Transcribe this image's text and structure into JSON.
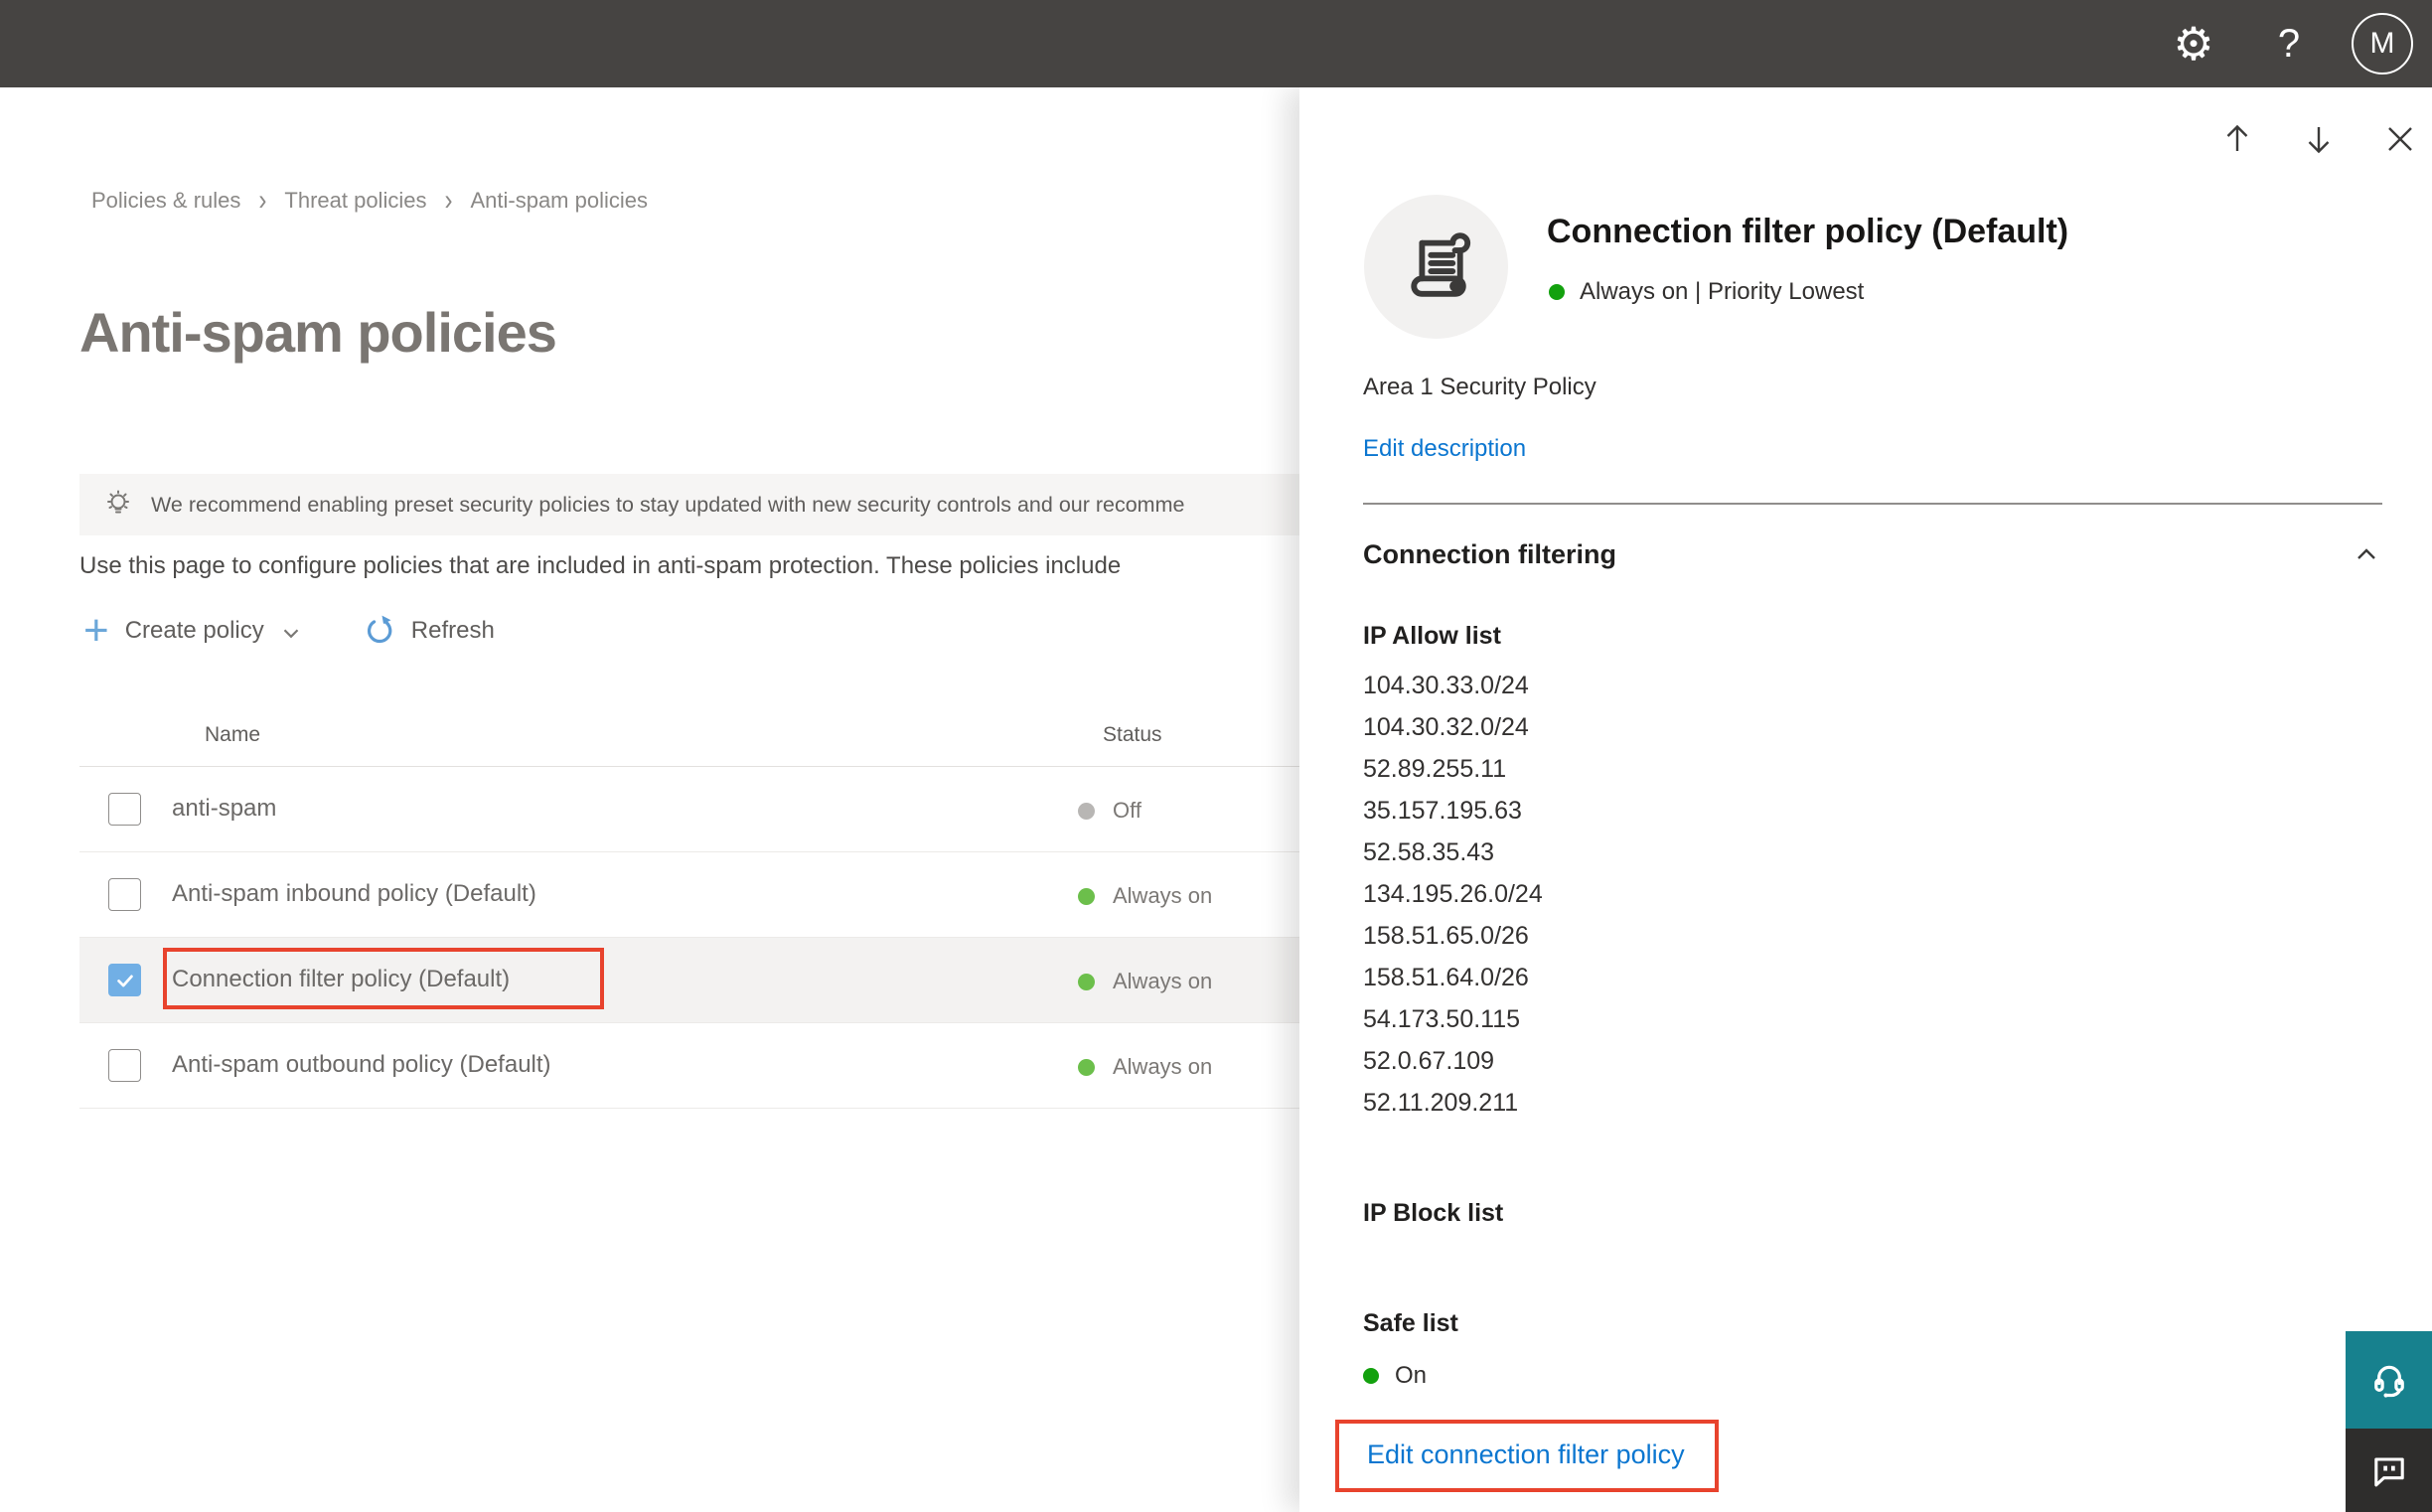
{
  "topbar": {
    "avatar_initial": "M",
    "help_glyph": "?"
  },
  "breadcrumb": {
    "items": [
      "Policies & rules",
      "Threat policies",
      "Anti-spam policies"
    ],
    "separator": "›"
  },
  "page": {
    "title": "Anti-spam policies",
    "banner_text": "We recommend enabling preset security policies to stay updated with new security controls and our recomme",
    "description": "Use this page to configure policies that are included in anti-spam protection. These policies include",
    "toolbar": {
      "create_policy": "Create policy",
      "refresh": "Refresh"
    }
  },
  "table": {
    "columns": {
      "name": "Name",
      "status": "Status"
    },
    "rows": [
      {
        "name": "anti-spam",
        "status": "Off",
        "status_kind": "off",
        "checked": false,
        "highlighted": false
      },
      {
        "name": "Anti-spam inbound policy (Default)",
        "status": "Always on",
        "status_kind": "on",
        "checked": false,
        "highlighted": false
      },
      {
        "name": "Connection filter policy (Default)",
        "status": "Always on",
        "status_kind": "on",
        "checked": true,
        "highlighted": true
      },
      {
        "name": "Anti-spam outbound policy (Default)",
        "status": "Always on",
        "status_kind": "on",
        "checked": false,
        "highlighted": false
      }
    ]
  },
  "panel": {
    "title": "Connection filter policy (Default)",
    "status_line": "Always on | Priority Lowest",
    "description": "Area 1 Security Policy",
    "edit_description_label": "Edit description",
    "section_title": "Connection filtering",
    "ip_allow": {
      "label": "IP Allow list",
      "ips": [
        "104.30.33.0/24",
        "104.30.32.0/24",
        "52.89.255.11",
        "35.157.195.63",
        "52.58.35.43",
        "134.195.26.0/24",
        "158.51.65.0/26",
        "158.51.64.0/26",
        "54.173.50.115",
        "52.0.67.109",
        "52.11.209.211"
      ]
    },
    "ip_block_label": "IP Block list",
    "safe_list": {
      "label": "Safe list",
      "value": "On"
    },
    "edit_link_label": "Edit connection filter policy"
  },
  "colors": {
    "topbar_bg": "#464442",
    "accent_blue": "#0b76d0",
    "checkbox_blue": "#71afe5",
    "green_on": "#6cbf4b",
    "green_bright": "#13a10e",
    "gray_off": "#b8b6b4",
    "red_highlight": "#e8432d",
    "teal_help": "#17818e"
  }
}
